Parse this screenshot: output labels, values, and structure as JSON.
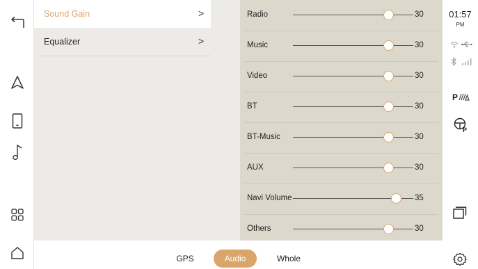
{
  "menu": {
    "items": [
      {
        "label": "Sound Gain",
        "chevron": ">"
      },
      {
        "label": "Equalizer",
        "chevron": ">"
      }
    ]
  },
  "sliders": [
    {
      "label": "Radio",
      "value": "30",
      "level": 0.795
    },
    {
      "label": "Music",
      "value": "30",
      "level": 0.795
    },
    {
      "label": "Video",
      "value": "30",
      "level": 0.795
    },
    {
      "label": "BT",
      "value": "30",
      "level": 0.795
    },
    {
      "label": "BT-Music",
      "value": "30",
      "level": 0.795
    },
    {
      "label": "AUX",
      "value": "30",
      "level": 0.795
    },
    {
      "label": "Navi Volume",
      "value": "35",
      "level": 0.86
    },
    {
      "label": "Others",
      "value": "30",
      "level": 0.795
    }
  ],
  "tabs": [
    {
      "label": "GPS",
      "active": false
    },
    {
      "label": "Audio",
      "active": true
    },
    {
      "label": "Whole",
      "active": false
    }
  ],
  "status": {
    "time": "01:57",
    "ampm": "PM"
  },
  "nav": [
    "back-icon",
    "navigation-icon",
    "phone-icon",
    "music-icon",
    "apps-grid-icon",
    "home-icon"
  ],
  "colors": {
    "accent": "#d9a56b",
    "menu_bg": "#ecebe7",
    "slider_bg": "#ddd8cc"
  }
}
